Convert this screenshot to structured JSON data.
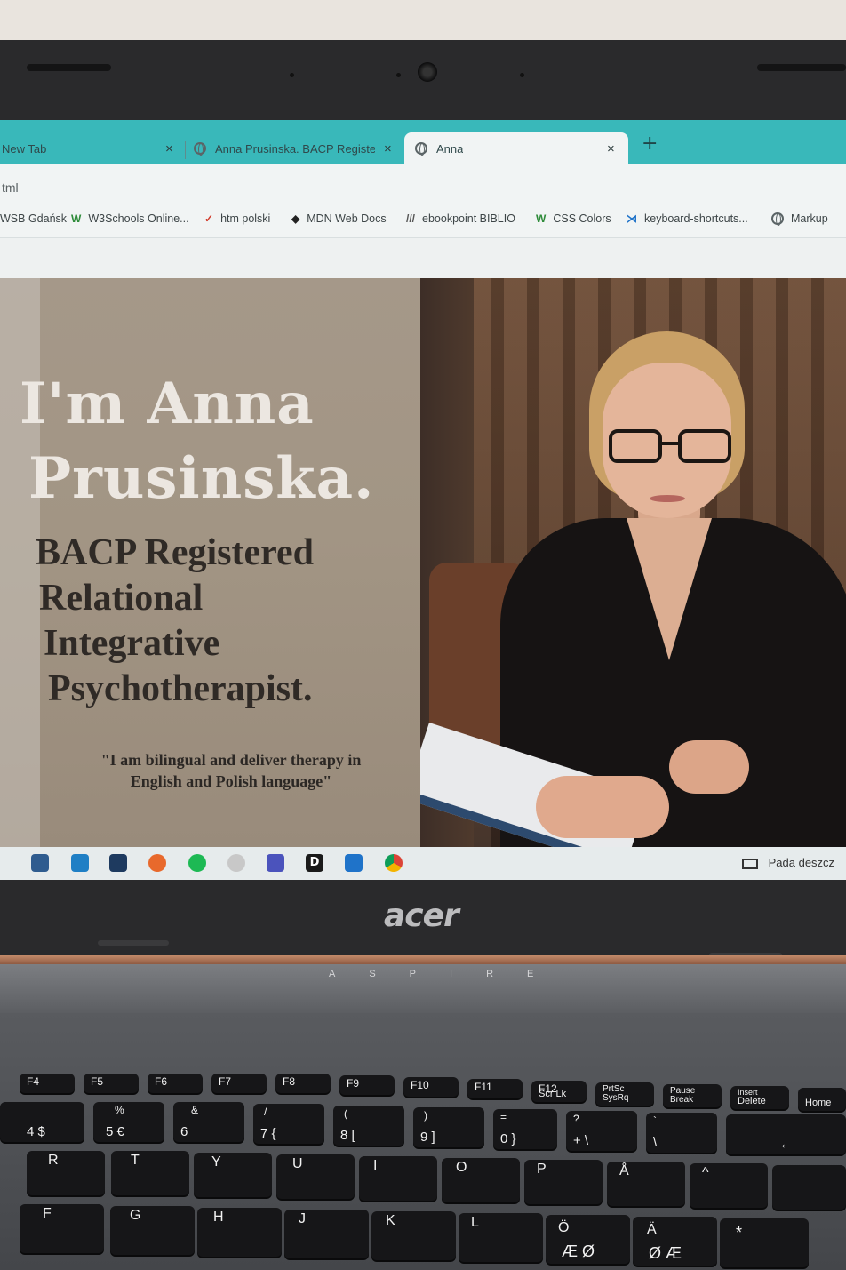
{
  "browser": {
    "tabs": [
      {
        "label": "New Tab",
        "close": "×",
        "active": false
      },
      {
        "label": "Anna Prusinska. BACP Registered",
        "close": "×",
        "active": false
      },
      {
        "label": "Anna",
        "close": "×",
        "active": true
      }
    ],
    "new_tab": "+",
    "address": "tml",
    "bookmarks": [
      {
        "label": "WSB Gdańsk",
        "icon": "bookmark-icon"
      },
      {
        "label": "W3Schools Online...",
        "icon": "w3schools-icon",
        "glyph": "W"
      },
      {
        "label": "htm polski",
        "icon": "pin-icon",
        "glyph": "✓"
      },
      {
        "label": "MDN Web Docs",
        "icon": "mdn-icon",
        "glyph": "◆"
      },
      {
        "label": "ebookpoint BIBLIO",
        "icon": "ebookpoint-icon",
        "glyph": "///"
      },
      {
        "label": "CSS Colors",
        "icon": "w3schools-icon",
        "glyph": "W"
      },
      {
        "label": "keyboard-shortcuts...",
        "icon": "vscode-icon",
        "glyph": "⋊"
      },
      {
        "label": "Markup",
        "icon": "globe-icon",
        "glyph": ""
      }
    ]
  },
  "hero": {
    "title_line1": "I'm Anna",
    "title_line2": "Prusinska.",
    "subtitle_lines": [
      "BACP Registered",
      "Relational",
      "Integrative",
      "Psychotherapist."
    ],
    "quote_line1": "\"I am bilingual and deliver therapy in",
    "quote_line2": "English and Polish language\""
  },
  "taskbar": {
    "weather": "Pada deszcz",
    "icons": [
      "explorer-icon",
      "store-icon",
      "mail-icon",
      "dropbox-icon",
      "firefox-icon",
      "spotify-icon",
      "app-icon",
      "teams-icon",
      "d-app-icon",
      "vscode-icon",
      "chrome-icon"
    ]
  },
  "laptop": {
    "brand": "acer",
    "model": "ASPIRE"
  },
  "keyboard": {
    "row_f": [
      "F4",
      "F5",
      "F6",
      "F7",
      "F8",
      "F9",
      "F10",
      "F11",
      "F12",
      "PrtSc",
      "Pause",
      "Insert",
      "Home"
    ],
    "row_f_sub": [
      "",
      "",
      "",
      "",
      "",
      "",
      "",
      "",
      "Scr Lk",
      "SysRq",
      "Break",
      "Delete",
      ""
    ],
    "row_num_top": [
      "",
      "%",
      "&",
      "/",
      "(",
      ")",
      "=",
      "?",
      "`",
      ""
    ],
    "row_num_bot": [
      "4 $",
      "5 €",
      "6",
      "7 {",
      "8 [",
      "9 ]",
      "0 }",
      "+ \\",
      "\\",
      "←"
    ],
    "row_q": [
      "R",
      "T",
      "Y",
      "U",
      "I",
      "O",
      "P",
      "Å",
      "^",
      ""
    ],
    "row_a": [
      "F",
      "G",
      "H",
      "J",
      "K",
      "L",
      "Ö",
      "Ä",
      "*"
    ],
    "row_a_sub": [
      "",
      "",
      "",
      "",
      "",
      "",
      "Æ Ø",
      "Ø Æ",
      ""
    ]
  }
}
